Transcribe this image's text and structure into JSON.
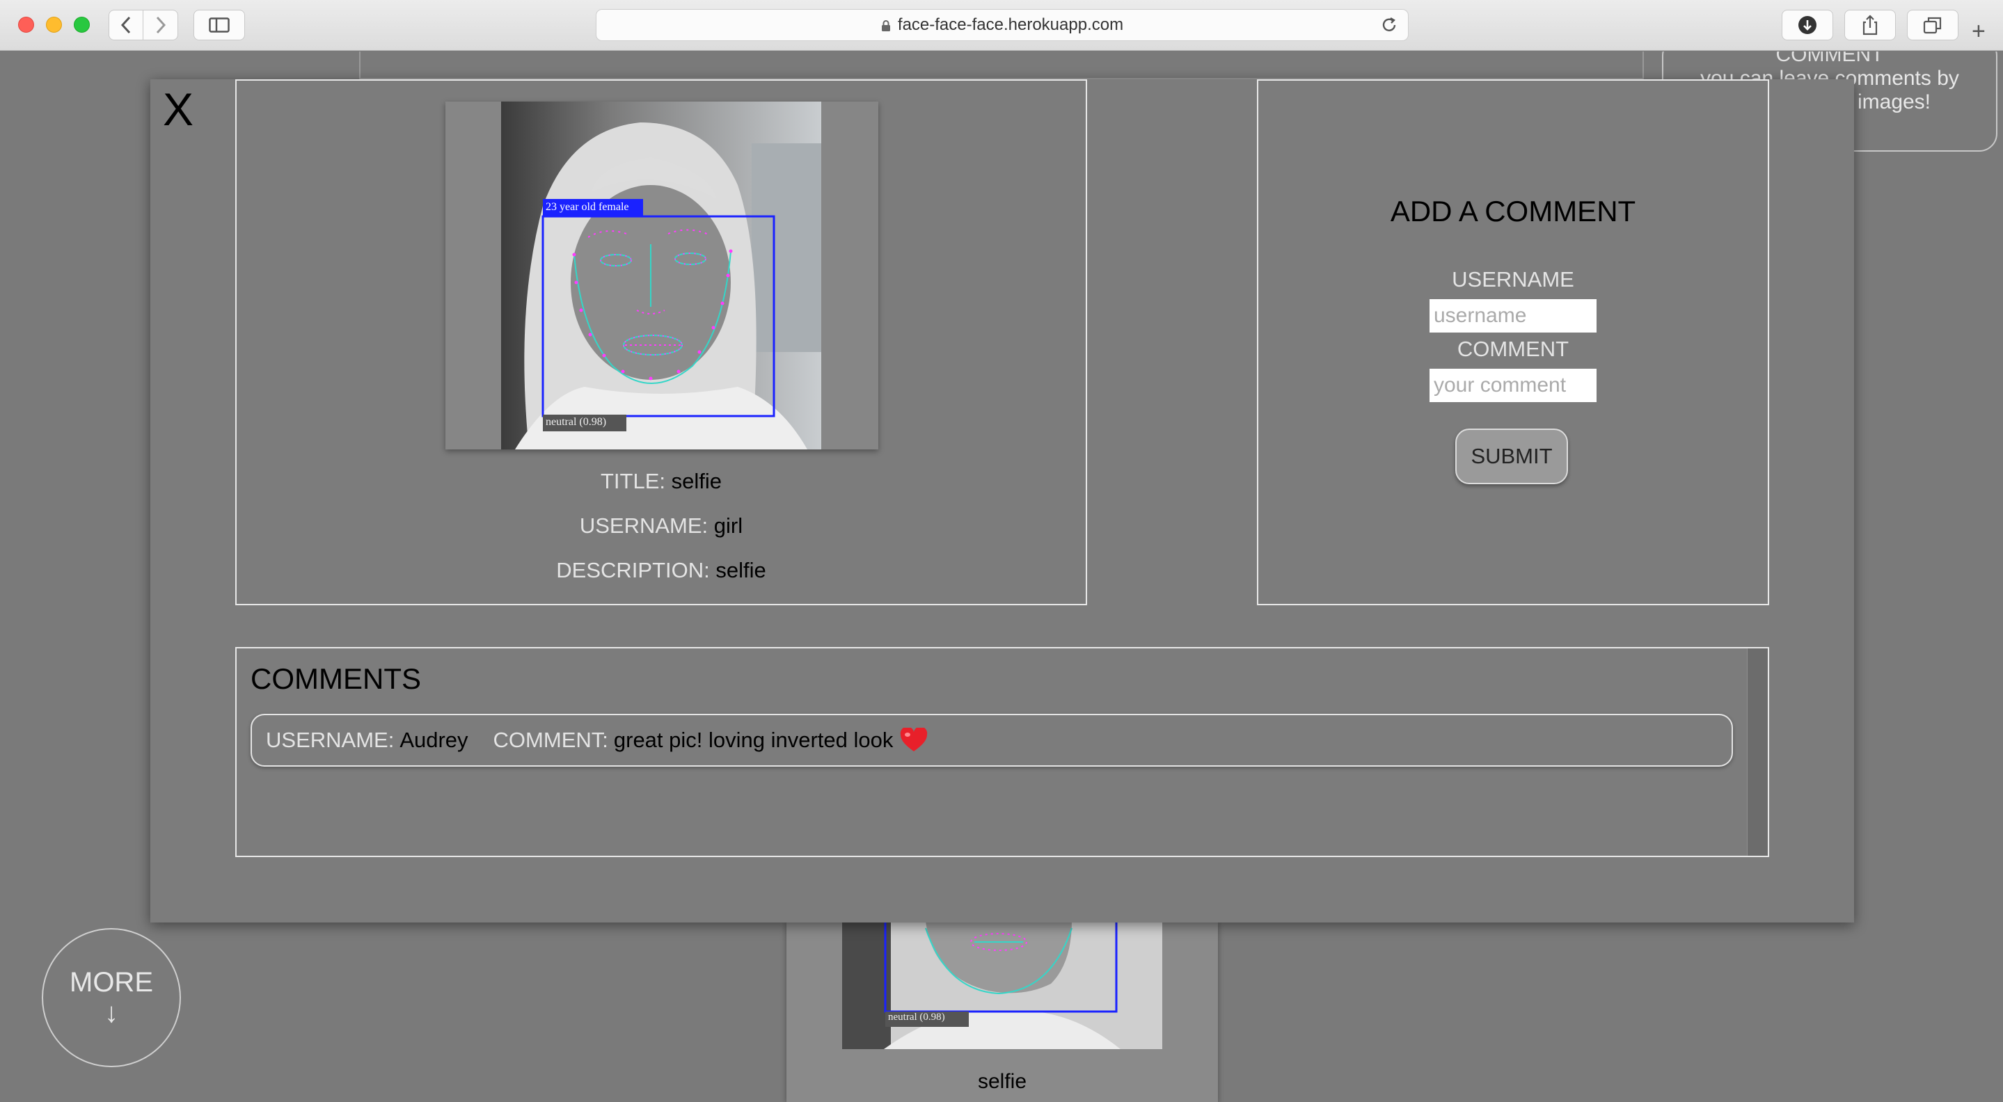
{
  "browser": {
    "url": "face-face-face.herokuapp.com",
    "icons": [
      "back-icon",
      "forward-icon",
      "sidebar-icon",
      "lock-icon",
      "reload-icon",
      "download-icon",
      "share-icon",
      "tabs-icon",
      "new-tab-icon"
    ]
  },
  "background": {
    "info_title": "COMMENT",
    "info_text": "you can leave comments by",
    "info_text2": "e images!",
    "thumb_emotion": "neutral (0.98)",
    "thumb_caption": "selfie",
    "more_label": "MORE",
    "more_arrow": "↓"
  },
  "modal": {
    "close_label": "X",
    "photo": {
      "age_gender_label": "23 year old female",
      "emotion_label": "neutral (0.98)",
      "accent": "#1a22ff",
      "landmark_color": "#ff3cff",
      "contour_color": "#35d6c8"
    },
    "meta": {
      "title_key": "TITLE:",
      "title_value": "selfie",
      "username_key": "USERNAME:",
      "username_value": "girl",
      "description_key": "DESCRIPTION:",
      "description_value": "selfie"
    },
    "add_comment": {
      "heading": "ADD A COMMENT",
      "username_label": "USERNAME",
      "username_placeholder": "username",
      "comment_label": "COMMENT",
      "comment_placeholder": "your comment",
      "submit_label": "SUBMIT"
    },
    "comments": {
      "heading": "COMMENTS",
      "items": [
        {
          "username_key": "USERNAME:",
          "username": "Audrey",
          "comment_key": "COMMENT:",
          "comment": "great pic! loving inverted look",
          "emoji": "heart-icon"
        }
      ]
    }
  }
}
